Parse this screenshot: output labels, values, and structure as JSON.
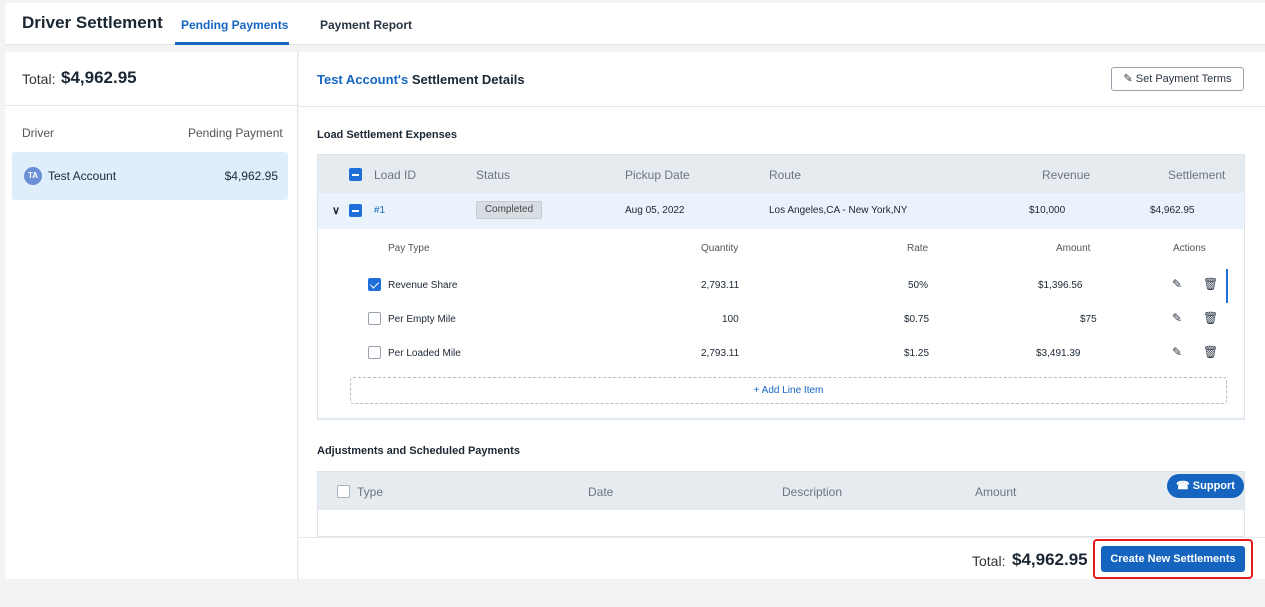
{
  "header": {
    "app_title": "Driver Settlement",
    "tabs": [
      {
        "label": "Pending Payments",
        "active": true
      },
      {
        "label": "Payment Report",
        "active": false
      }
    ]
  },
  "sidebar": {
    "total_label": "Total:",
    "total_value": "$4,962.95",
    "col_driver": "Driver",
    "col_pending": "Pending Payment",
    "drivers": [
      {
        "initials": "TA",
        "name": "Test Account",
        "amount": "$4,962.95",
        "selected": true
      }
    ]
  },
  "details": {
    "account_name": "Test Account's",
    "title_rest": "Settlement Details",
    "set_terms_label": "Set Payment Terms",
    "load_section_label": "Load Settlement Expenses",
    "load_columns": [
      "Load ID",
      "Status",
      "Pickup Date",
      "Route",
      "Revenue",
      "Settlement"
    ],
    "load": {
      "id": "#1",
      "status": "Completed",
      "pickup_date": "Aug 05, 2022",
      "route": "Los Angeles,CA - New York,NY",
      "revenue": "$10,000",
      "settlement": "$4,962.95"
    },
    "line_columns": [
      "Pay Type",
      "Quantity",
      "Rate",
      "Amount",
      "Actions"
    ],
    "line_items": [
      {
        "pay_type": "Revenue Share",
        "quantity": "2,793.11",
        "rate": "50%",
        "amount": "$1,396.56",
        "checked": true
      },
      {
        "pay_type": "Per Empty Mile",
        "quantity": "100",
        "rate": "$0.75",
        "amount": "$75",
        "checked": false
      },
      {
        "pay_type": "Per Loaded Mile",
        "quantity": "2,793.11",
        "rate": "$1.25",
        "amount": "$3,491.39",
        "checked": false
      }
    ],
    "add_line_label": "+ Add Line Item",
    "adj_section_label": "Adjustments and Scheduled Payments",
    "adj_columns": [
      "Type",
      "Date",
      "Description",
      "Amount"
    ],
    "support_label": "Support",
    "footer_total_label": "Total:",
    "footer_total_value": "$4,962.95",
    "create_label": "Create New Settlements"
  },
  "colors": {
    "accent": "#1565c0",
    "highlight": "#e11b1b",
    "selected_row": "#dfeefb"
  }
}
